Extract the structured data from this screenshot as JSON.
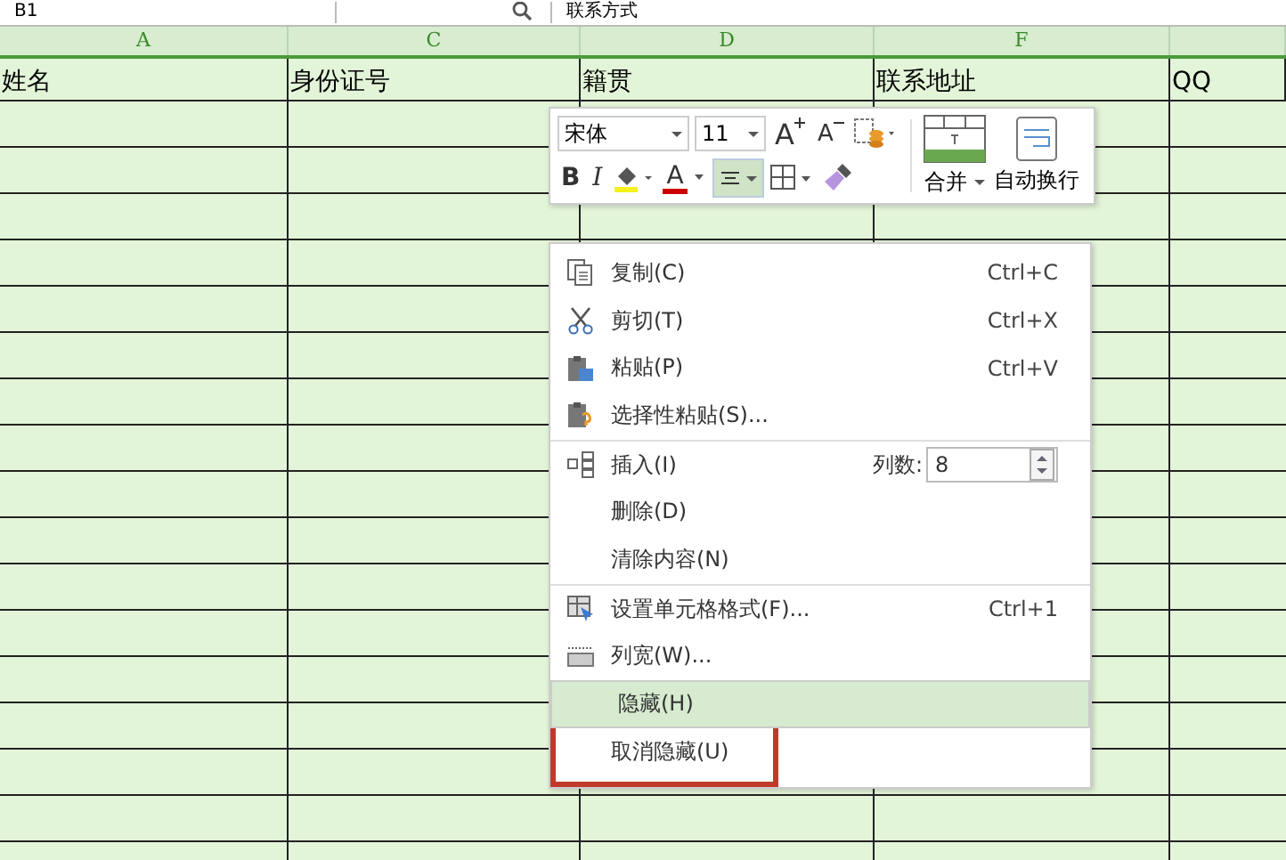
{
  "formula_bar": {
    "cell_ref": "B1",
    "content": "联系方式"
  },
  "sheet": {
    "columns": [
      {
        "letter": "A",
        "header": "姓名"
      },
      {
        "letter": "C",
        "header": "身份证号"
      },
      {
        "letter": "D",
        "header": "籍贯"
      },
      {
        "letter": "F",
        "header": "联系地址"
      },
      {
        "header": "QQ"
      }
    ]
  },
  "mini_toolbar": {
    "font": "宋体",
    "size": "11",
    "grow_font": "A",
    "shrink_font": "A",
    "bold": "B",
    "italic": "I",
    "font_color": "A",
    "align_selected": true,
    "merge": "合并",
    "wrap": "自动换行"
  },
  "context_menu": {
    "items": [
      {
        "kind": "item",
        "label": "复制(C)",
        "shortcut": "Ctrl+C",
        "selected": false,
        "annotated": false
      },
      {
        "kind": "item",
        "label": "剪切(T)",
        "shortcut": "Ctrl+X",
        "selected": false,
        "annotated": false
      },
      {
        "kind": "item",
        "label": "粘贴(P)",
        "shortcut": "Ctrl+V",
        "selected": false,
        "annotated": false
      },
      {
        "kind": "item",
        "label": "选择性粘贴(S)...",
        "selected": false,
        "annotated": false
      },
      {
        "kind": "separator"
      },
      {
        "kind": "spin",
        "label": "插入(I)",
        "field_label": "列数:",
        "value": "8",
        "selected": false,
        "annotated": false
      },
      {
        "kind": "item",
        "label": "删除(D)",
        "selected": false,
        "annotated": false
      },
      {
        "kind": "item",
        "label": "清除内容(N)",
        "selected": false,
        "annotated": false
      },
      {
        "kind": "separator"
      },
      {
        "kind": "item",
        "label": "设置单元格格式(F)...",
        "shortcut": "Ctrl+1",
        "selected": false,
        "annotated": false
      },
      {
        "kind": "item",
        "label": "列宽(W)...",
        "selected": false,
        "annotated": false
      },
      {
        "kind": "item",
        "label": "隐藏(H)",
        "selected": true,
        "annotated": false
      },
      {
        "kind": "item",
        "label": "取消隐藏(U)",
        "selected": false,
        "annotated": true
      }
    ]
  }
}
